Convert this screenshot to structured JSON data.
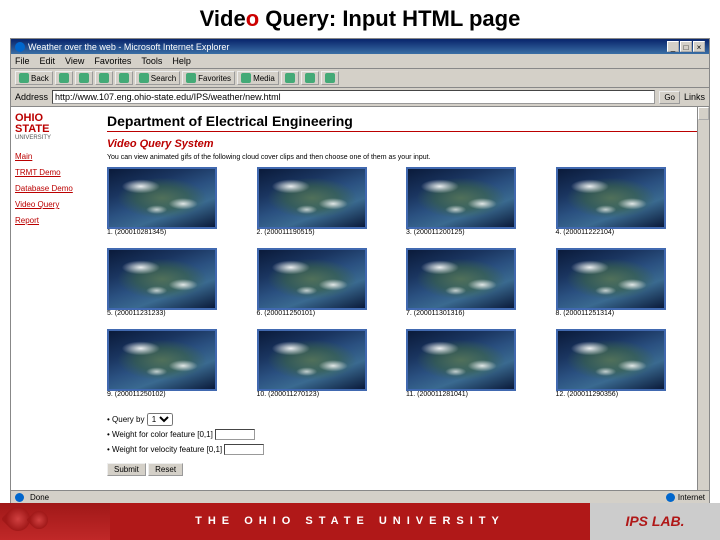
{
  "slide_title": {
    "pre": "Vide",
    "o": "o",
    "mid": " Query: ",
    "rest": "Input HTML page"
  },
  "browser": {
    "title": "Weather over the web - Microsoft Internet Explorer",
    "menus": [
      "File",
      "Edit",
      "View",
      "Favorites",
      "Tools",
      "Help"
    ],
    "tool_buttons": [
      "Back",
      "",
      "",
      "",
      "Search",
      "Favorites",
      "Media",
      "",
      "",
      "",
      ""
    ],
    "address_label": "Address",
    "url": "http://www.107.eng.ohio-state.edu/IPS/weather/new.html",
    "go": "Go",
    "links": "Links"
  },
  "logo": {
    "line1": "OHIO",
    "line2": "STATE",
    "sub": "UNIVERSITY"
  },
  "nav": [
    "Main",
    "TRMT Demo",
    "Database Demo",
    "Video Query",
    "Report"
  ],
  "dept": "Department of Electrical Engineering",
  "vqs": "Video Query System",
  "instruction": "You can view animated gifs of the following cloud cover clips and then choose one of them as your input.",
  "clips": [
    {
      "n": "1.",
      "id": "(200010281345)"
    },
    {
      "n": "2.",
      "id": "(200011190515)"
    },
    {
      "n": "3.",
      "id": "(200011200125)"
    },
    {
      "n": "4.",
      "id": "(200011222104)"
    },
    {
      "n": "5.",
      "id": "(200011231233)"
    },
    {
      "n": "6.",
      "id": "(200011250101)"
    },
    {
      "n": "7.",
      "id": "(200011301316)"
    },
    {
      "n": "8.",
      "id": "(200011251314)"
    },
    {
      "n": "9.",
      "id": "(200011250102)"
    },
    {
      "n": "10.",
      "id": "(200011270123)"
    },
    {
      "n": "11.",
      "id": "(200011281041)"
    },
    {
      "n": "12.",
      "id": "(200011290356)"
    }
  ],
  "form": {
    "query_label": "• Query by",
    "query_options": [
      "1"
    ],
    "weight_color": "• Weight for color feature [0,1]",
    "weight_velocity": "• Weight for velocity feature [0,1]",
    "submit": "Submit",
    "reset": "Reset"
  },
  "status": {
    "done": "Done",
    "zone": "Internet"
  },
  "footer": {
    "uni": "THE OHIO STATE UNIVERSITY",
    "lab": "IPS LAB."
  }
}
